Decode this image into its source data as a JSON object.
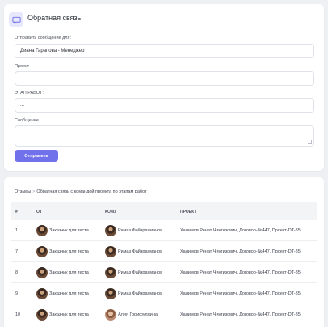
{
  "feedback_form": {
    "title": "Обратная связь",
    "recipient_label": "Отправить сообщение для:",
    "recipient_value": "Диана Гарапова - Менеджер",
    "project_label": "Проект",
    "project_value": "...",
    "stage_label": "ЭТАП РАБОТ:",
    "stage_value": "...",
    "message_label": "Сообщение",
    "message_value": "",
    "submit_label": "Отправить"
  },
  "reviews": {
    "breadcrumb_root": "Отзывы",
    "breadcrumb_separator": ">",
    "breadcrumb_current": "Обратная связь с командой проекта по этапам работ",
    "columns": [
      "#",
      "ОТ",
      "КОМУ",
      "ПРОЕКТ"
    ],
    "rows": [
      {
        "id": "1",
        "from": "Заказчик для теста",
        "to": "Римаз Файзрахманов",
        "project": "Халимов Ренат Чингизович, Договор-№447, Проект-DT-85"
      },
      {
        "id": "7",
        "from": "Заказчик для теста",
        "to": "Римаз Файзрахманов",
        "project": "Халимов Ренат Чингизович, Договор-№447, Проект-DT-85"
      },
      {
        "id": "8",
        "from": "Заказчик для теста",
        "to": "Римаз Файзрахманов",
        "project": "Халимов Ренат Чингизович, Договор-№447, Проект-DT-85"
      },
      {
        "id": "9",
        "from": "Заказчик для теста",
        "to": "Римаз Файзрахманов",
        "project": "Халимов Ренат Чингизович, Договор-№447, Проект-DT-85"
      },
      {
        "id": "10",
        "from": "Заказчик для теста",
        "to": "Алия Горифуллина",
        "project": "Халимов Ренат Чингизович, Договор-№447, Проект-DT-85"
      }
    ]
  },
  "colors": {
    "accent": "#7271ec",
    "background": "#eef0f4",
    "table_header": "#f3f4f6"
  },
  "icons": {
    "header": "chat-bubble-icon",
    "avatar": "user-avatar"
  }
}
